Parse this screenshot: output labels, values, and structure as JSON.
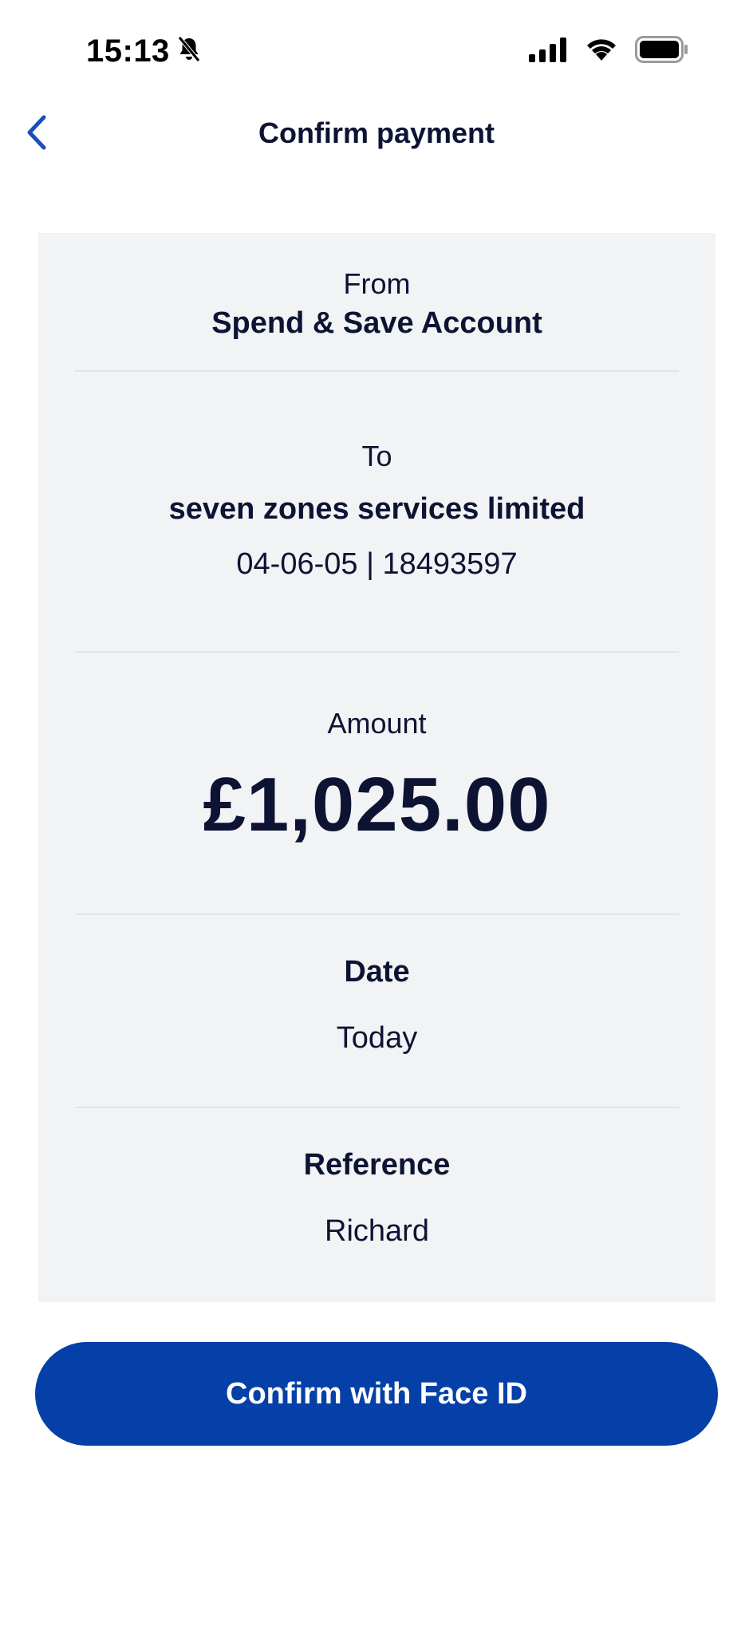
{
  "status_bar": {
    "time": "15:13"
  },
  "header": {
    "title": "Confirm payment"
  },
  "payment": {
    "from_label": "From",
    "from_account": "Spend & Save Account",
    "to_label": "To",
    "payee_name": "seven zones services limited",
    "payee_details": "04-06-05 | 18493597",
    "amount_label": "Amount",
    "amount": "£1,025.00",
    "date_label": "Date",
    "date_value": "Today",
    "reference_label": "Reference",
    "reference_value": "Richard"
  },
  "actions": {
    "confirm_label": "Confirm with Face ID"
  },
  "colors": {
    "primary": "#0440a8",
    "text": "#0d1433",
    "card_bg": "#f2f3f5",
    "back_icon": "#1a4fb8"
  },
  "icons": {
    "silent_mode": "bell-slash-icon",
    "signal": "cellular-signal-icon",
    "wifi": "wifi-icon",
    "battery": "battery-icon",
    "back": "chevron-left-icon"
  }
}
